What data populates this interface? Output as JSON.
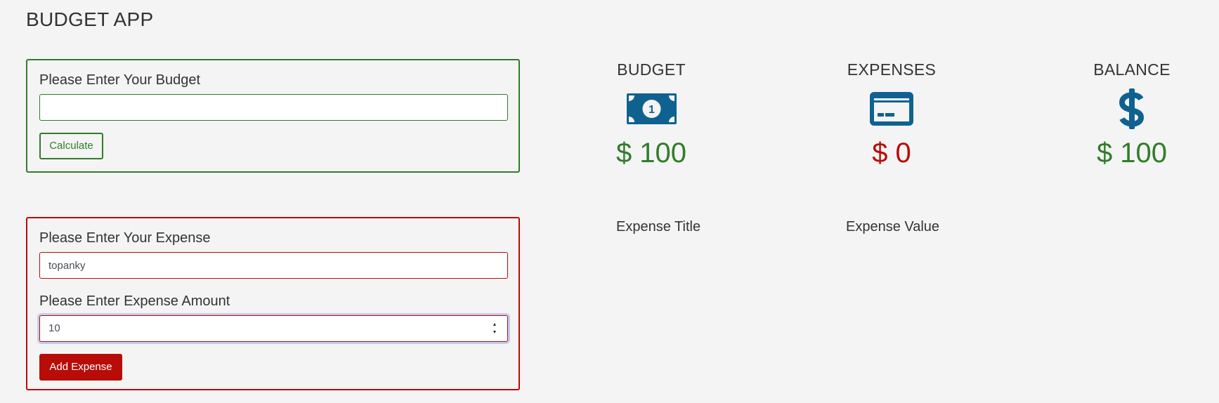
{
  "app": {
    "title": "BUDGET APP"
  },
  "budget_form": {
    "label": "Please Enter Your Budget",
    "input_value": "",
    "button_label": "Calculate"
  },
  "expense_form": {
    "title_label": "Please Enter Your Expense",
    "title_value": "topanky",
    "amount_label": "Please Enter Expense Amount",
    "amount_value": "10",
    "button_label": "Add Expense"
  },
  "summary": {
    "budget": {
      "title": "BUDGET",
      "amount": "$ 100",
      "icon": "money-bill-icon"
    },
    "expenses": {
      "title": "EXPENSES",
      "amount": "$ 0",
      "icon": "credit-card-icon"
    },
    "balance": {
      "title": "BALANCE",
      "amount": "$ 100",
      "icon": "dollar-sign-icon"
    }
  },
  "expense_list": {
    "columns": [
      "Expense Title",
      "Expense Value"
    ]
  },
  "colors": {
    "green": "#317c2a",
    "red": "#b80c09",
    "icon_blue": "#0f6290",
    "background": "#f4f4f4"
  }
}
